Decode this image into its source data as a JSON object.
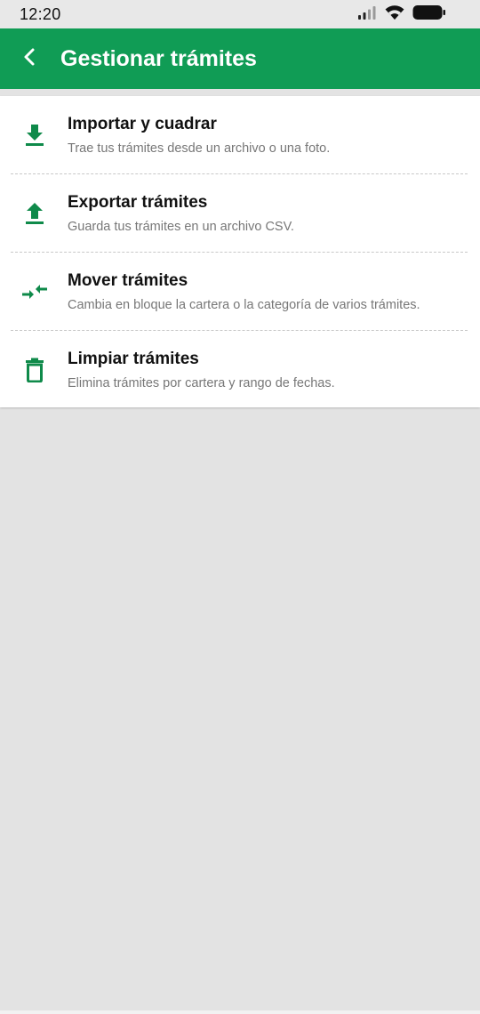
{
  "status_bar": {
    "time": "12:20",
    "icons": [
      "signal-icon",
      "wifi-icon",
      "battery-icon"
    ]
  },
  "app_bar": {
    "title": "Gestionar trámites",
    "back_icon": "chevron-left-icon",
    "color": "#109c55"
  },
  "menu": {
    "accent_color": "#0f8a4a",
    "items": [
      {
        "title": "Importar y cuadrar",
        "subtitle": "Trae tus trámites desde un archivo o una foto.",
        "icon": "download-icon"
      },
      {
        "title": "Exportar trámites",
        "subtitle": "Guarda tus trámites en un archivo CSV.",
        "icon": "upload-icon"
      },
      {
        "title": "Mover trámites",
        "subtitle": "Cambia en bloque la cartera o la categoría de varios trámites.",
        "icon": "swap-arrows-icon"
      },
      {
        "title": "Limpiar trámites",
        "subtitle": "Elimina trámites por cartera y rango de fechas.",
        "icon": "trash-icon"
      }
    ]
  }
}
